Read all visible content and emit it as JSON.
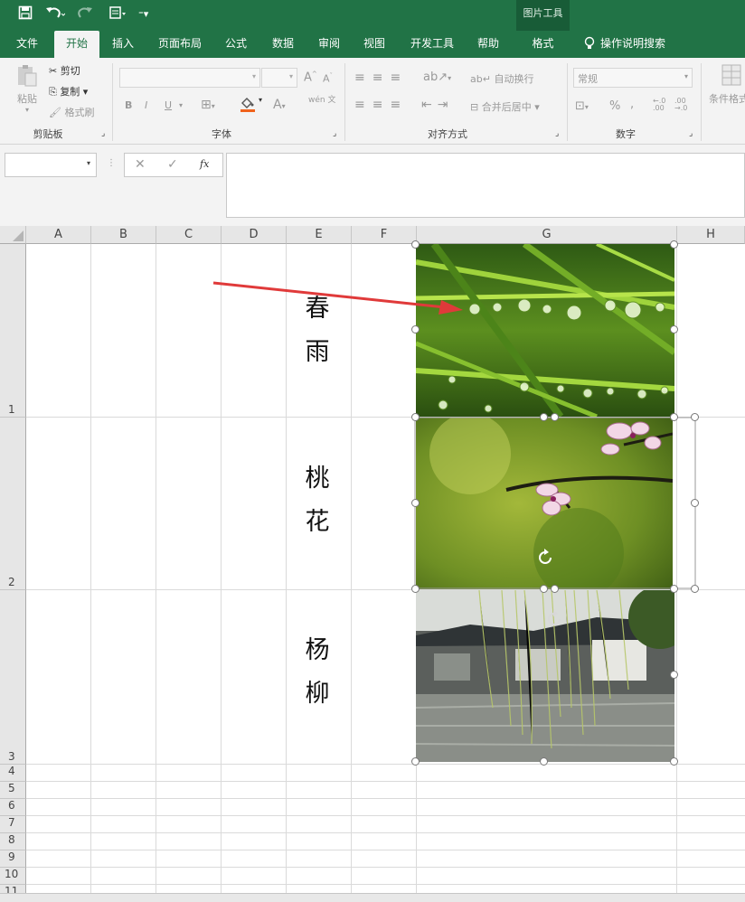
{
  "quick_access": {
    "save_icon": "save-icon",
    "undo_icon": "undo-icon",
    "redo_icon": "redo-icon",
    "form_icon": "form-icon",
    "customize_icon": "customize-icon"
  },
  "contextual_tab_group": "图片工具",
  "tabs": [
    {
      "label": "文件"
    },
    {
      "label": "开始"
    },
    {
      "label": "插入"
    },
    {
      "label": "页面布局"
    },
    {
      "label": "公式"
    },
    {
      "label": "数据"
    },
    {
      "label": "审阅"
    },
    {
      "label": "视图"
    },
    {
      "label": "开发工具"
    },
    {
      "label": "帮助"
    },
    {
      "label": "格式"
    }
  ],
  "tell_me": "操作说明搜索",
  "ribbon": {
    "clipboard": {
      "paste": "粘贴",
      "cut": "剪切",
      "copy": "复制",
      "format_painter": "格式刷",
      "label": "剪贴板"
    },
    "font": {
      "label": "字体",
      "bold": "B",
      "italic": "I",
      "underline": "U",
      "wen": "wén 文"
    },
    "alignment": {
      "label": "对齐方式",
      "wrap": "自动换行",
      "merge": "合并后居中"
    },
    "number": {
      "label": "数字",
      "format": "常规",
      "percent": "%",
      "comma": ","
    },
    "styles": {
      "conditional": "条件格式"
    }
  },
  "formula_bar": {
    "cancel": "✕",
    "confirm": "✓",
    "fx": "fx"
  },
  "columns": [
    "A",
    "B",
    "C",
    "D",
    "E",
    "F",
    "G",
    "H"
  ],
  "rows": [
    "1",
    "2",
    "3",
    "4",
    "5",
    "6",
    "7",
    "8",
    "9",
    "10",
    "11"
  ],
  "cells": {
    "E1": [
      "春",
      "雨"
    ],
    "E2": [
      "桃",
      "花"
    ],
    "E3": [
      "杨",
      "柳"
    ]
  },
  "colors": {
    "accent": "#217346",
    "arrow": "#e03a3a"
  }
}
